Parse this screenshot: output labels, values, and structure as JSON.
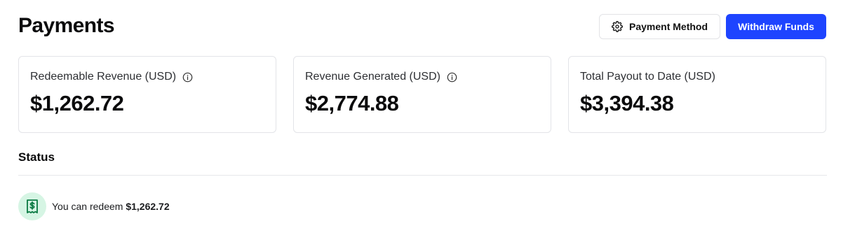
{
  "header": {
    "title": "Payments",
    "payment_method_label": "Payment Method",
    "withdraw_label": "Withdraw Funds"
  },
  "cards": [
    {
      "label": "Redeemable Revenue (USD)",
      "value": "$1,262.72",
      "has_info": true
    },
    {
      "label": "Revenue Generated (USD)",
      "value": "$2,774.88",
      "has_info": true
    },
    {
      "label": "Total Payout to Date (USD)",
      "value": "$3,394.38",
      "has_info": false
    }
  ],
  "status": {
    "heading": "Status",
    "message_prefix": "You can redeem",
    "amount": "$1,262.72"
  },
  "colors": {
    "primary": "#1e44ff",
    "status_icon_bg": "#d6f5e4",
    "status_icon_fg": "#0b7a43"
  },
  "icons": {
    "payment_method": "gear-icon",
    "card_info": "info-icon",
    "status": "receipt-dollar-icon"
  }
}
